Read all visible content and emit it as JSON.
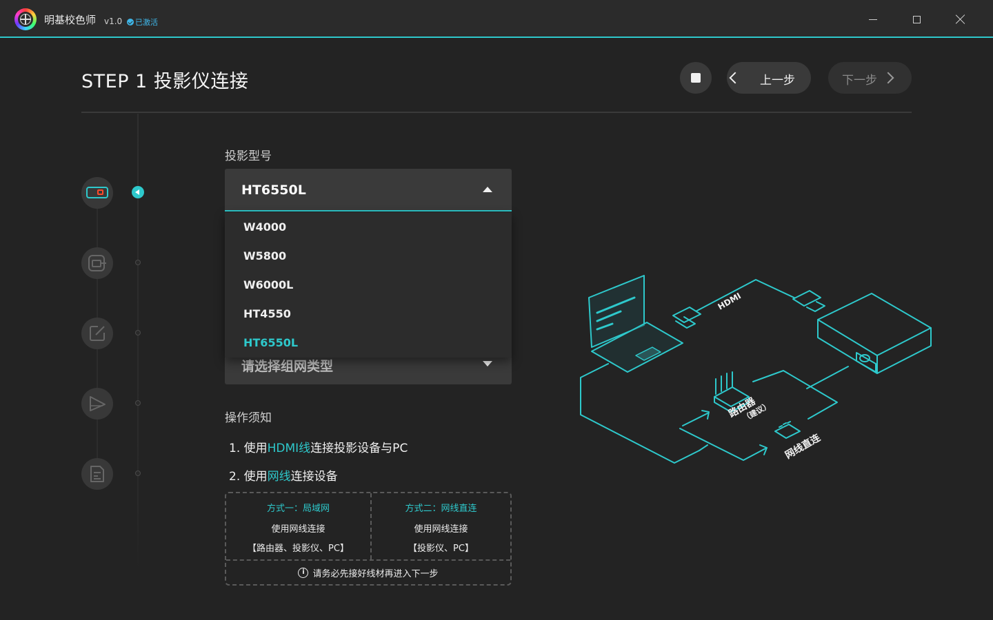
{
  "titlebar": {
    "app_name": "明基校色师",
    "version": "v1.0",
    "status": "已激活",
    "icons": [
      "logo-icon",
      "check-icon",
      "minimize-icon",
      "maximize-icon",
      "close-icon"
    ]
  },
  "header": {
    "step_title": "STEP 1 投影仪连接",
    "prev_label": "上一步",
    "next_label": "下一步"
  },
  "stepper": {
    "icons": [
      "projector-icon",
      "display-icon",
      "edit-icon",
      "triangle-icon",
      "document-icon"
    ],
    "active_index": 0
  },
  "form": {
    "model_label": "投影型号",
    "selected_model": "HT6550L",
    "options": [
      "W4000",
      "W5800",
      "W6000L",
      "HT4550",
      "HT6550L"
    ],
    "network_placeholder": "请选择组网类型"
  },
  "instructions": {
    "title": "操作须知",
    "step1": {
      "prefix": "1. 使用",
      "highlight": "HDMI线",
      "suffix": "连接投影设备与PC"
    },
    "step2": {
      "prefix": "2. 使用",
      "highlight": "网线",
      "suffix": "连接设备"
    },
    "methods": [
      {
        "title": "方式一：局域网",
        "line1": "使用网线连接",
        "line2": "【路由器、投影仪、PC】"
      },
      {
        "title": "方式二：网线直连",
        "line1": "使用网线连接",
        "line2": "【投影仪、PC】"
      }
    ],
    "notice": "请务必先接好线材再进入下一步"
  },
  "diagram": {
    "hdmi_label": "HDMI",
    "router_label": "路由器",
    "router_sub": "（建议）",
    "direct_label": "网线直连"
  },
  "colors": {
    "accent": "#2ec9cc",
    "background": "#232323",
    "panel": "#3a3a3a",
    "activated": "#3fb6e8"
  }
}
